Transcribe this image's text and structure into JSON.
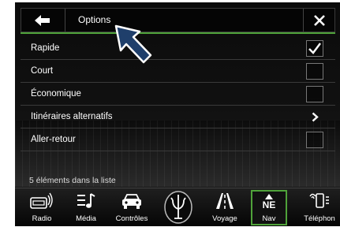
{
  "header": {
    "title": "Options"
  },
  "list": {
    "items": [
      {
        "label": "Rapide",
        "control": "checkbox",
        "checked": true
      },
      {
        "label": "Court",
        "control": "checkbox",
        "checked": false
      },
      {
        "label": "Économique",
        "control": "checkbox",
        "checked": false
      },
      {
        "label": "Itinéraires alternatifs",
        "control": "chevron"
      },
      {
        "label": "Aller-retour",
        "control": "checkbox",
        "checked": false
      }
    ],
    "count_text": "5 éléments dans la liste"
  },
  "nav": {
    "items": [
      {
        "label": "Radio",
        "icon": "radio-icon"
      },
      {
        "label": "Média",
        "icon": "media-icon"
      },
      {
        "label": "Contrôles",
        "icon": "car-icon"
      },
      {
        "label": "",
        "icon": "trident-logo-icon"
      },
      {
        "label": "Voyage",
        "icon": "road-icon"
      },
      {
        "label": "Nav",
        "icon": "compass-icon",
        "compass_text": "NE",
        "active": true
      },
      {
        "label": "Téléphon",
        "icon": "phone-icon"
      }
    ]
  },
  "colors": {
    "accent": "#4fa23a",
    "pointer": "#1f3f6b"
  }
}
